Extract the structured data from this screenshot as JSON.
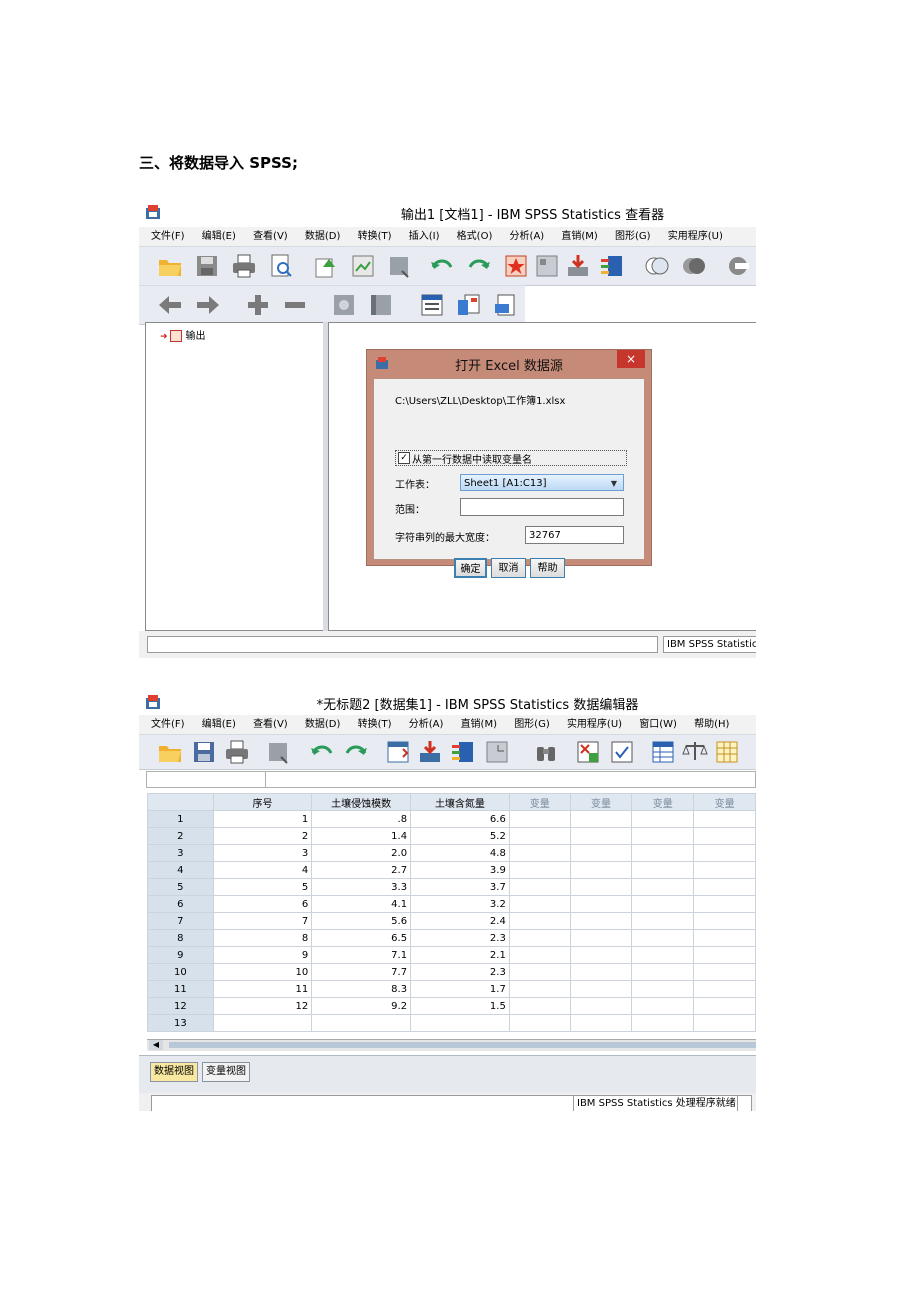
{
  "doc": {
    "heading": "三、将数据导入 SPSS;"
  },
  "viewer": {
    "title": "输出1 [文档1] - IBM SPSS Statistics 查看器",
    "menu": [
      "文件(F)",
      "编辑(E)",
      "查看(V)",
      "数据(D)",
      "转换(T)",
      "插入(I)",
      "格式(O)",
      "分析(A)",
      "直销(M)",
      "图形(G)",
      "实用程序(U)"
    ],
    "tree_item": "输出",
    "status": "IBM SPSS Statistic"
  },
  "dialog": {
    "title": "打开 Excel 数据源",
    "close": "×",
    "path": "C:\\Users\\ZLL\\Desktop\\工作簿1.xlsx",
    "checkbox_label": "从第一行数据中读取变量名",
    "checkbox_mark": "✓",
    "sheet_label": "工作表：",
    "sheet_value": "Sheet1 [A1:C13]",
    "range_label": "范围：",
    "range_value": "",
    "width_label": "字符串列的最大宽度：",
    "width_value": "32767",
    "ok": "确定",
    "cancel": "取消",
    "help": "帮助"
  },
  "editor": {
    "title": "*无标题2 [数据集1] - IBM SPSS Statistics 数据编辑器",
    "menu": [
      "文件(F)",
      "编辑(E)",
      "查看(V)",
      "数据(D)",
      "转换(T)",
      "分析(A)",
      "直销(M)",
      "图形(G)",
      "实用程序(U)",
      "窗口(W)",
      "帮助(H)"
    ],
    "columns": [
      "序号",
      "土壤侵蚀模数",
      "土壤含氮量",
      "变量",
      "变量",
      "变量",
      "变量"
    ],
    "rows": [
      {
        "n": "1",
        "a": "1",
        "b": ".8",
        "c": "6.6"
      },
      {
        "n": "2",
        "a": "2",
        "b": "1.4",
        "c": "5.2"
      },
      {
        "n": "3",
        "a": "3",
        "b": "2.0",
        "c": "4.8"
      },
      {
        "n": "4",
        "a": "4",
        "b": "2.7",
        "c": "3.9"
      },
      {
        "n": "5",
        "a": "5",
        "b": "3.3",
        "c": "3.7"
      },
      {
        "n": "6",
        "a": "6",
        "b": "4.1",
        "c": "3.2"
      },
      {
        "n": "7",
        "a": "7",
        "b": "5.6",
        "c": "2.4"
      },
      {
        "n": "8",
        "a": "8",
        "b": "6.5",
        "c": "2.3"
      },
      {
        "n": "9",
        "a": "9",
        "b": "7.1",
        "c": "2.1"
      },
      {
        "n": "10",
        "a": "10",
        "b": "7.7",
        "c": "2.3"
      },
      {
        "n": "11",
        "a": "11",
        "b": "8.3",
        "c": "1.7"
      },
      {
        "n": "12",
        "a": "12",
        "b": "9.2",
        "c": "1.5"
      },
      {
        "n": "13",
        "a": "",
        "b": "",
        "c": ""
      }
    ],
    "tab_data": "数据视图",
    "tab_variable": "变量视图",
    "status": "IBM SPSS Statistics 处理程序就绪"
  }
}
